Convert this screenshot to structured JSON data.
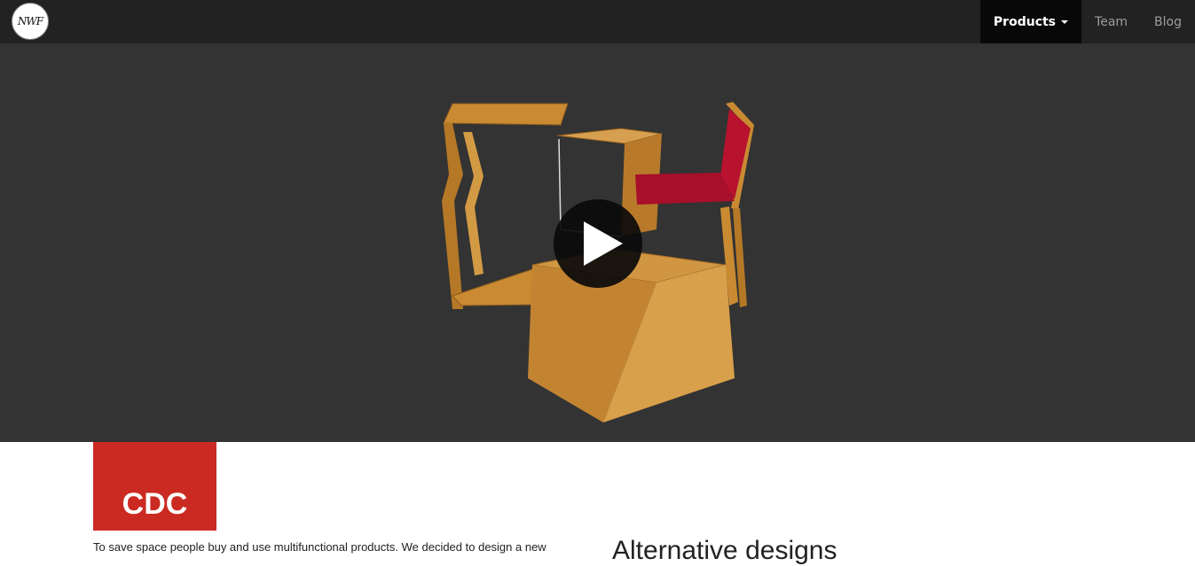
{
  "header": {
    "logo_text": "NWF",
    "nav": [
      {
        "label": "Products",
        "active": true,
        "dropdown": true
      },
      {
        "label": "Team",
        "active": false
      },
      {
        "label": "Blog",
        "active": false
      }
    ]
  },
  "hero": {
    "media": "product-video-thumbnail",
    "play_icon": "play-icon"
  },
  "product": {
    "title": "CDC",
    "intro": "To save space people buy and use multifunctional products. We decided to design a new",
    "alt_heading": "Alternative designs"
  },
  "colors": {
    "navbar": "#222222",
    "nav_active": "#080808",
    "hero_bg": "#333333",
    "accent_red": "#cb2a22",
    "wood": "#c98a32",
    "seat_red": "#b8122e"
  }
}
